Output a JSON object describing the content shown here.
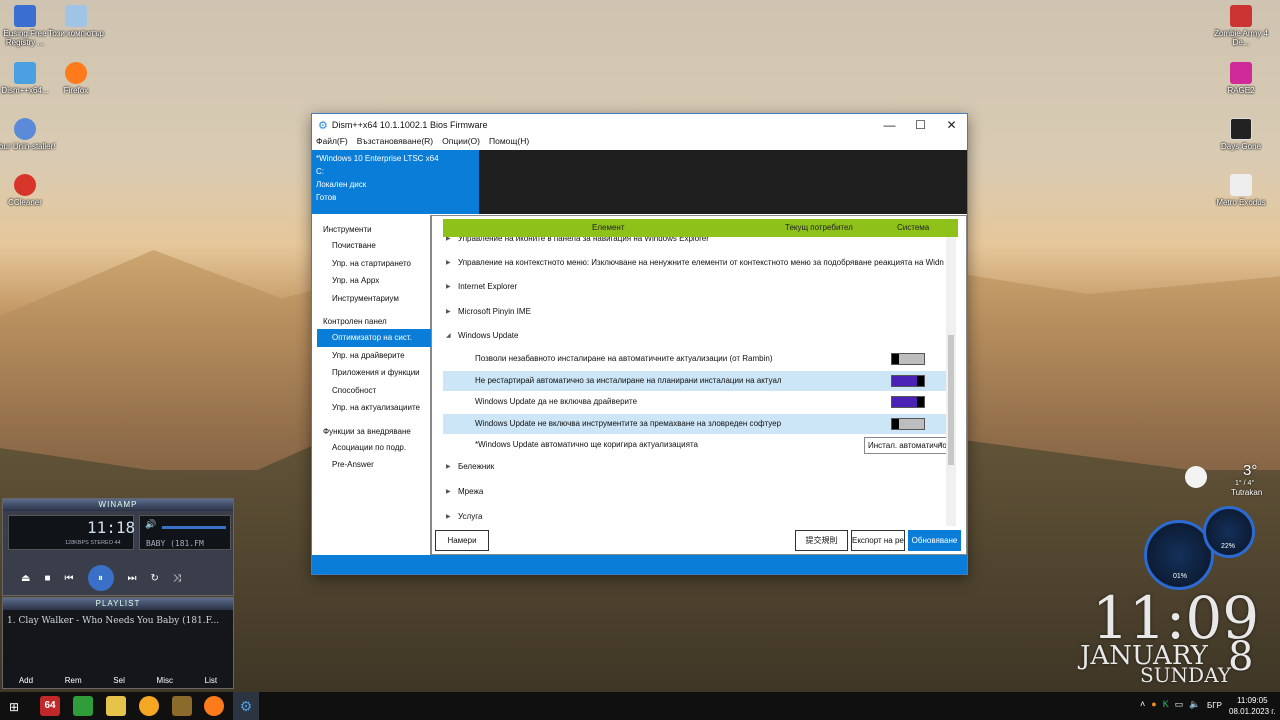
{
  "desktop": {
    "icons_left": [
      {
        "label": "Eusing Free Registry ...",
        "name": "eusing-registry-icon"
      },
      {
        "label": "Този компютър",
        "name": "this-pc-icon"
      },
      {
        "label": "Dism++x64...",
        "name": "dism-icon"
      },
      {
        "label": "Firefox",
        "name": "firefox-icon"
      },
      {
        "label": "Your Unin-staller!",
        "name": "uninstaller-icon"
      },
      {
        "label": "CCleaner",
        "name": "ccleaner-icon"
      }
    ],
    "icons_right": [
      {
        "label": "Zombie Army 4 De...",
        "name": "zombie-army-icon"
      },
      {
        "label": "RAGE2",
        "name": "rage2-icon"
      },
      {
        "label": "Days Gone",
        "name": "days-gone-icon"
      },
      {
        "label": "Metro Exodus",
        "name": "metro-exodus-icon"
      }
    ]
  },
  "window": {
    "title": "Dism++x64 10.1.1002.1 Bios Firmware",
    "menu": [
      "Файл(F)",
      "Възстановяване(R)",
      "Опции(O)",
      "Помощ(H)"
    ],
    "info": [
      "*Windows 10 Enterprise LTSC x64",
      "C:",
      "Локален диск",
      "Готов"
    ],
    "sidebar": [
      {
        "type": "group",
        "label": "Инструменти"
      },
      {
        "type": "item",
        "label": "Почистване"
      },
      {
        "type": "item",
        "label": "Упр. на стартирането"
      },
      {
        "type": "item",
        "label": "Упр. на Appx"
      },
      {
        "type": "item",
        "label": "Инструментариум"
      },
      {
        "type": "group",
        "label": "Контролен панел"
      },
      {
        "type": "item",
        "label": "Оптимизатор на сист.",
        "selected": true
      },
      {
        "type": "item",
        "label": "Упр. на драйверите"
      },
      {
        "type": "item",
        "label": "Приложения и функции"
      },
      {
        "type": "item",
        "label": "Способност"
      },
      {
        "type": "item",
        "label": "Упр. на актуализациите"
      },
      {
        "type": "group",
        "label": "Функции за внедряване"
      },
      {
        "type": "item",
        "label": "Асоциации по подр."
      },
      {
        "type": "item",
        "label": "Pre-Answer"
      }
    ],
    "table_header": {
      "element": "Елемент",
      "current_user": "Текущ потребител",
      "system": "Система"
    },
    "rows": [
      {
        "label": "Управление на иконите в панела за навигация на Windows Explorer",
        "kind": "group"
      },
      {
        "label": "Управление на контекстното меню: Изключване на ненужните елементи от контекстното меню за подобряване реакцията на Widn",
        "kind": "group"
      },
      {
        "label": "Internet Explorer",
        "kind": "group"
      },
      {
        "label": "Microsoft Pinyin IME",
        "kind": "group"
      },
      {
        "label": "Windows Update",
        "kind": "group-open"
      },
      {
        "label": "Позволи незабавното инсталиране на автоматичните актуализации (от Rambin)",
        "kind": "toggle",
        "on": false,
        "hl": false
      },
      {
        "label": "Не рестартирай автоматично за инсталиране на планирани инсталации на актуализации",
        "kind": "toggle",
        "on": true,
        "hl": true
      },
      {
        "label": "Windows Update да не включва драйверите",
        "kind": "toggle",
        "on": true,
        "hl": false
      },
      {
        "label": "Windows Update не включва инструментите за премахване на зловреден софтуер (MRT)",
        "kind": "toggle",
        "on": false,
        "hl": true
      },
      {
        "label": "*Windows Update автоматично ще коригира актуализацията",
        "kind": "combo",
        "value": "Инстал. автоматично"
      },
      {
        "label": "Бележник",
        "kind": "group"
      },
      {
        "label": "Мрежа",
        "kind": "group"
      },
      {
        "label": "Услуга",
        "kind": "group"
      }
    ],
    "buttons": {
      "find": "Намери",
      "rules": "提交規則",
      "export": "Експорт на рег. ключ",
      "update": "Обновяване"
    }
  },
  "winamp": {
    "title": "WINAMP",
    "time": "11:18",
    "bitrate": "128KBPS STEREO 44",
    "ticker": "BABY (181.FM",
    "playlist_title": "PLAYLIST",
    "track": "1. Clay Walker - Who Needs You Baby (181.F...",
    "pl_buttons": [
      "Add",
      "Rem",
      "Sel",
      "Misc",
      "List"
    ]
  },
  "widgets": {
    "temp": "3°",
    "temp_range": "1° / 4°",
    "city": "Tutrakan",
    "gauge1": "01%",
    "gauge2": "22%"
  },
  "clock": {
    "time": "11:09",
    "month": "JANUARY",
    "day_num": "8",
    "weekday": "SUNDAY"
  },
  "taskbar": {
    "lang": "БГР",
    "time": "11:09:05",
    "date": "08.01.2023 г."
  },
  "colors": {
    "accent": "#0a7dd8",
    "header_green": "#8fc11b",
    "toggle_on": "#4a22b6"
  }
}
